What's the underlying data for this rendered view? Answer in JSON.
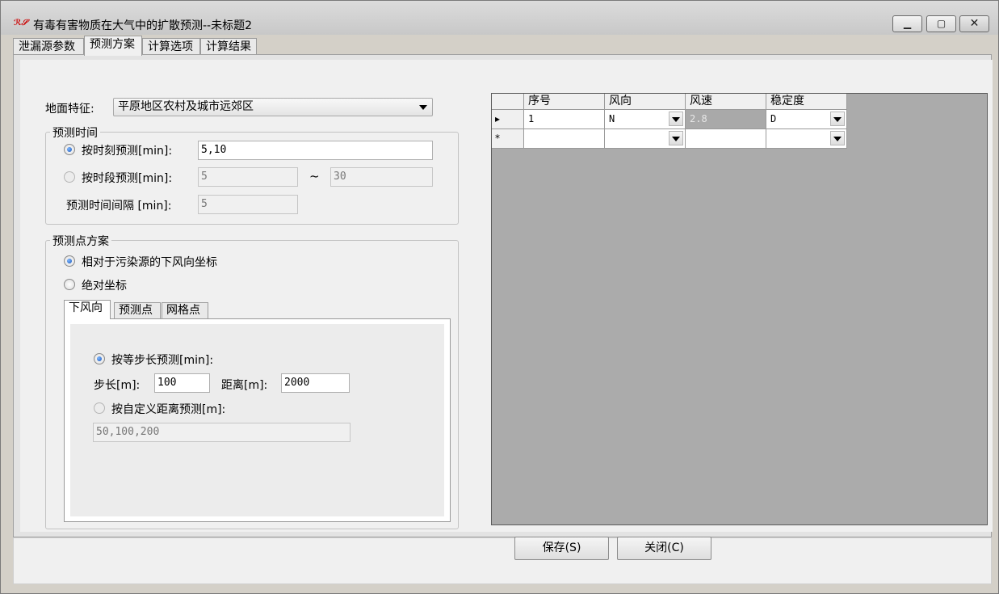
{
  "window": {
    "title": "有毒有害物质在大气中的扩散预测--未标题2",
    "minimize_icon": "minimize-icon",
    "maximize_icon": "maximize-icon",
    "close_icon": "close-icon",
    "app_icon": "app-logo-icon",
    "app_icon_text": "ℛ𝒮"
  },
  "tabs": [
    {
      "label": "泄漏源参数"
    },
    {
      "label": "预测方案"
    },
    {
      "label": "计算选项"
    },
    {
      "label": "计算结果"
    }
  ],
  "terrain": {
    "label": "地面特征:",
    "value": "平原地区农村及城市远郊区"
  },
  "forecast_time": {
    "title": "预测时间",
    "by_moment_label": "按时刻预测[min]:",
    "by_moment_value": "5,10",
    "by_period_label": "按时段预测[min]:",
    "period_from": "5",
    "period_sep": "~",
    "period_to": "30",
    "interval_label": "预测时间间隔 [min]:",
    "interval_value": "5"
  },
  "point_scheme": {
    "title": "预测点方案",
    "relative_label": "相对于污染源的下风向坐标",
    "absolute_label": "绝对坐标",
    "subtabs": [
      {
        "label": "下风向"
      },
      {
        "label": "预测点"
      },
      {
        "label": "网格点"
      }
    ],
    "equal_step_label": "按等步长预测[min]:",
    "step_label": "步长[m]:",
    "step_value": "100",
    "distance_label": "距离[m]:",
    "distance_value": "2000",
    "custom_label": "按自定义距离预测[m]:",
    "custom_value": "50,100,200"
  },
  "grid": {
    "columns": [
      "序号",
      "风向",
      "风速",
      "稳定度"
    ],
    "rows": [
      {
        "marker": "▸",
        "index": "1",
        "direction": "N",
        "speed": "2.8",
        "stability": "D"
      },
      {
        "marker": "*",
        "index": "",
        "direction": "",
        "speed": "",
        "stability": ""
      }
    ]
  },
  "buttons": {
    "save": "保存(S)",
    "close": "关闭(C)"
  }
}
